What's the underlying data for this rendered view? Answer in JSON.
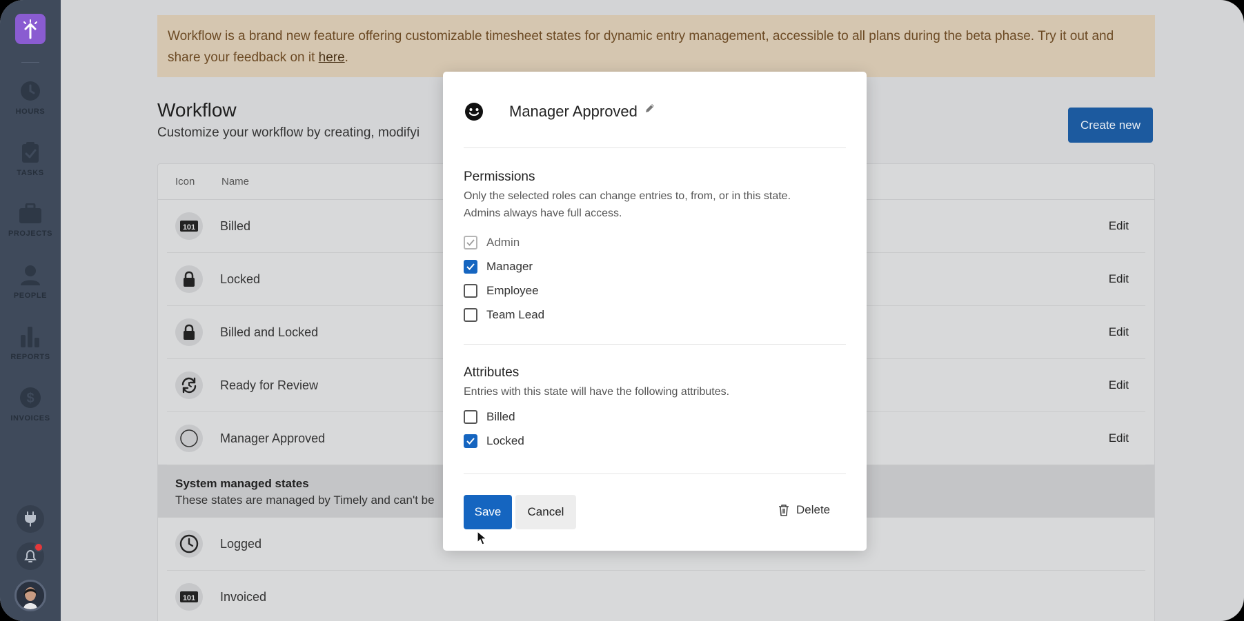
{
  "sidebar": {
    "items": [
      {
        "label": "HOURS",
        "icon": "clock-icon"
      },
      {
        "label": "TASKS",
        "icon": "clipboard-check-icon"
      },
      {
        "label": "PROJECTS",
        "icon": "briefcase-icon"
      },
      {
        "label": "PEOPLE",
        "icon": "person-icon"
      },
      {
        "label": "REPORTS",
        "icon": "bar-chart-icon"
      },
      {
        "label": "INVOICES",
        "icon": "dollar-icon"
      }
    ]
  },
  "banner": {
    "text": "Workflow is a brand new feature offering customizable timesheet states for dynamic entry management, accessible to all plans during the beta phase. Try it out and share your feedback on it ",
    "link": "here",
    "end": "."
  },
  "page": {
    "title": "Workflow",
    "subtitle": "Customize your workflow by creating, modifyi",
    "create_label": "Create new"
  },
  "table": {
    "headers": {
      "icon": "Icon",
      "name": "Name"
    },
    "rows": [
      {
        "name": "Billed",
        "icon": "billed-icon",
        "action": "Edit"
      },
      {
        "name": "Locked",
        "icon": "lock-icon",
        "action": "Edit"
      },
      {
        "name": "Billed and Locked",
        "icon": "lock-icon",
        "action": "Edit"
      },
      {
        "name": "Ready for Review",
        "icon": "refresh-icon",
        "action": "Edit"
      },
      {
        "name": "Manager Approved",
        "icon": "circle-icon",
        "action": "Edit"
      }
    ],
    "system": {
      "title": "System managed states",
      "desc": "These states are managed by Timely and can't be"
    },
    "system_rows": [
      {
        "name": "Logged",
        "icon": "clock-icon"
      },
      {
        "name": "Invoiced",
        "icon": "billed-icon"
      }
    ]
  },
  "modal": {
    "title": "Manager Approved",
    "icon": "smiley-icon",
    "permissions": {
      "title": "Permissions",
      "desc_line1": "Only the selected roles can change entries to, from, or in this state.",
      "desc_line2": "Admins always have full access.",
      "roles": [
        {
          "label": "Admin",
          "checked": true,
          "disabled": true
        },
        {
          "label": "Manager",
          "checked": true,
          "disabled": false
        },
        {
          "label": "Employee",
          "checked": false,
          "disabled": false
        },
        {
          "label": "Team Lead",
          "checked": false,
          "disabled": false
        }
      ]
    },
    "attributes": {
      "title": "Attributes",
      "desc": "Entries with this state will have the following attributes.",
      "items": [
        {
          "label": "Billed",
          "checked": false
        },
        {
          "label": "Locked",
          "checked": true
        }
      ]
    },
    "save_label": "Save",
    "cancel_label": "Cancel",
    "delete_label": "Delete"
  },
  "help": {
    "label": "?"
  },
  "colors": {
    "primary": "#1565c0",
    "sidebar": "#3f4a5b",
    "logo": "#8a5cd1",
    "banner": "#d5c6b0"
  }
}
